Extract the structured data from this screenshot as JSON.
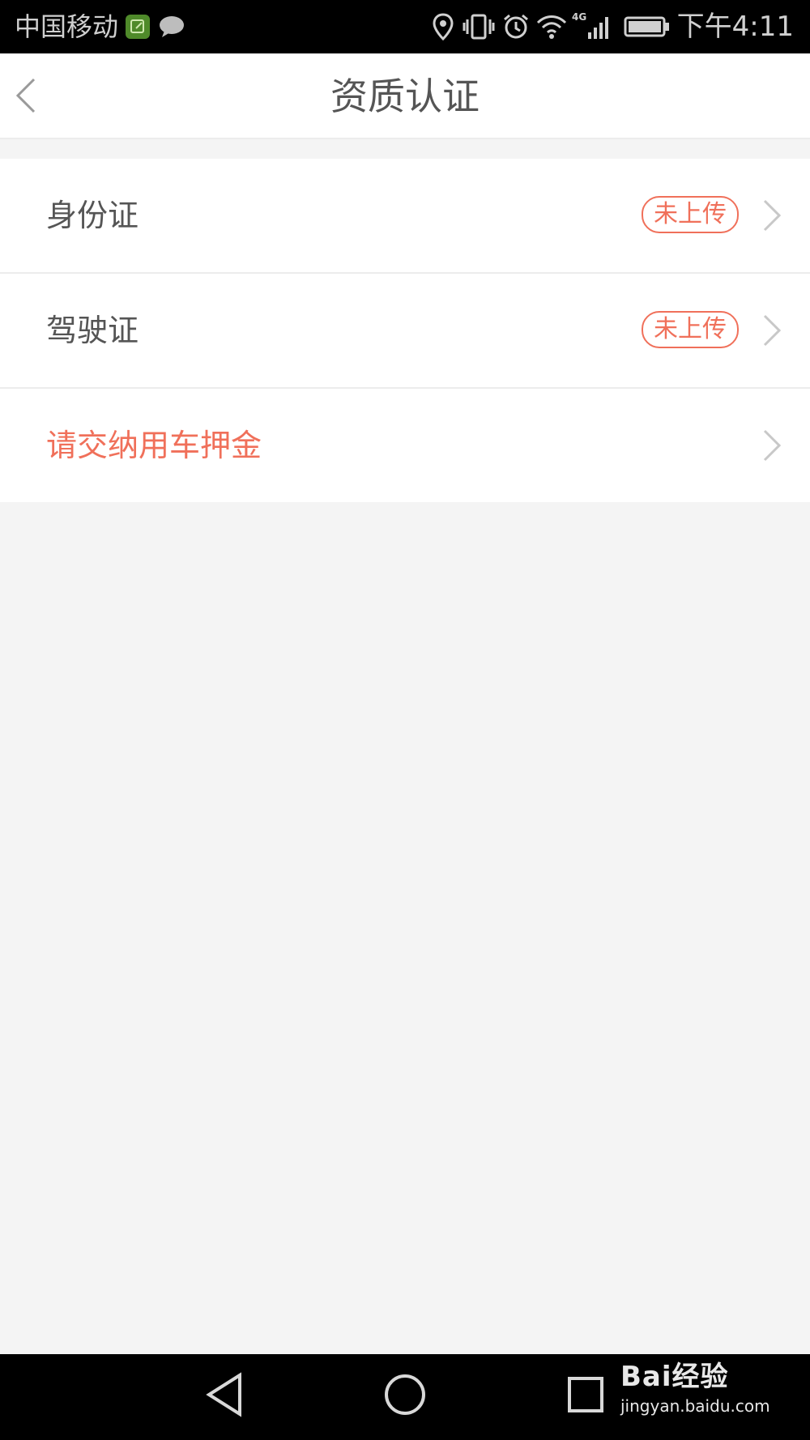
{
  "status_bar": {
    "carrier": "中国移动",
    "network": "4G",
    "time": "下午4:11"
  },
  "header": {
    "title": "资质认证"
  },
  "items": [
    {
      "label": "身份证",
      "status": "未上传"
    },
    {
      "label": "驾驶证",
      "status": "未上传"
    },
    {
      "label": "请交纳用车押金"
    }
  ],
  "watermark": {
    "brand": "Bai经验",
    "url": "jingyan.baidu.com"
  },
  "colors": {
    "accent": "#f0705a",
    "background": "#f4f4f4",
    "text": "#555555"
  }
}
